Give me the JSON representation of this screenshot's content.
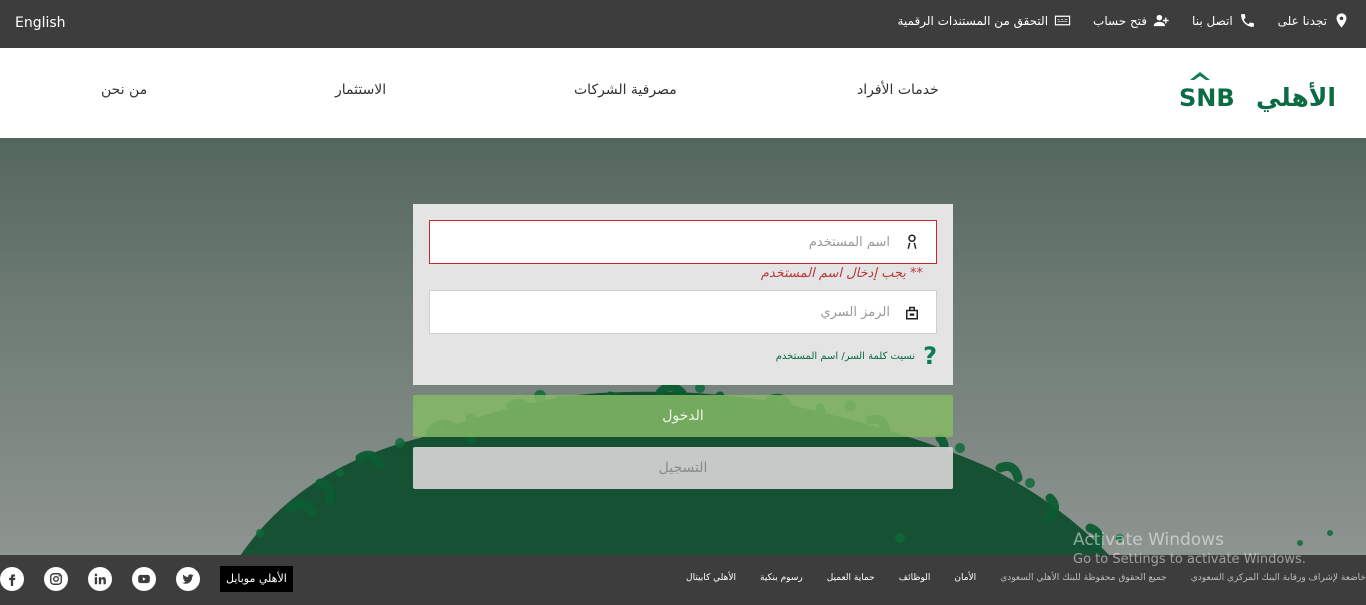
{
  "topbar": {
    "language": "English",
    "links": [
      {
        "label": "تجدنا على",
        "icon": "map-pin-icon"
      },
      {
        "label": "اتصل بنا",
        "icon": "phone-icon"
      },
      {
        "label": "فتح حساب",
        "icon": "add-user-icon"
      },
      {
        "label": "التحقق من المستندات الرقمية",
        "icon": "document-verify-icon"
      }
    ]
  },
  "header": {
    "logo_text": "SNB الأهلي",
    "nav": [
      "خدمات الأفراد",
      "مصرفية الشركات",
      "الاستثمار",
      "من نحن"
    ]
  },
  "login": {
    "username_placeholder": "اسم المستخدم",
    "username_error": "** يجب إدخال اسم المستخدم",
    "password_placeholder": "الرمز السري",
    "forgot_text": "نسيت كلمة السر/ اسم المستخدم",
    "login_button": "الدخول",
    "register_button": "التسجيل"
  },
  "footer": {
    "mobile_app": "الأهلي موبايل",
    "links": [
      "خاضعة لإشراف ورقابة البنك المركزي السعودي",
      "جميع الحقوق محفوظة للبنك الأهلي السعودي",
      "الأمان",
      "الوظائف",
      "حماية العميل",
      "رسوم بنكية",
      "الأهلي كابيتال"
    ],
    "social": [
      "facebook-icon",
      "instagram-icon",
      "linkedin-icon",
      "youtube-icon",
      "twitter-icon"
    ]
  },
  "watermark": {
    "line1": "Activate Windows",
    "line2": "Go to Settings to activate Windows."
  },
  "colors": {
    "brand_green": "#0b7d50",
    "bar_dark": "#3d3d3d",
    "error_red": "#c8282d",
    "login_green": "#85ba65"
  }
}
